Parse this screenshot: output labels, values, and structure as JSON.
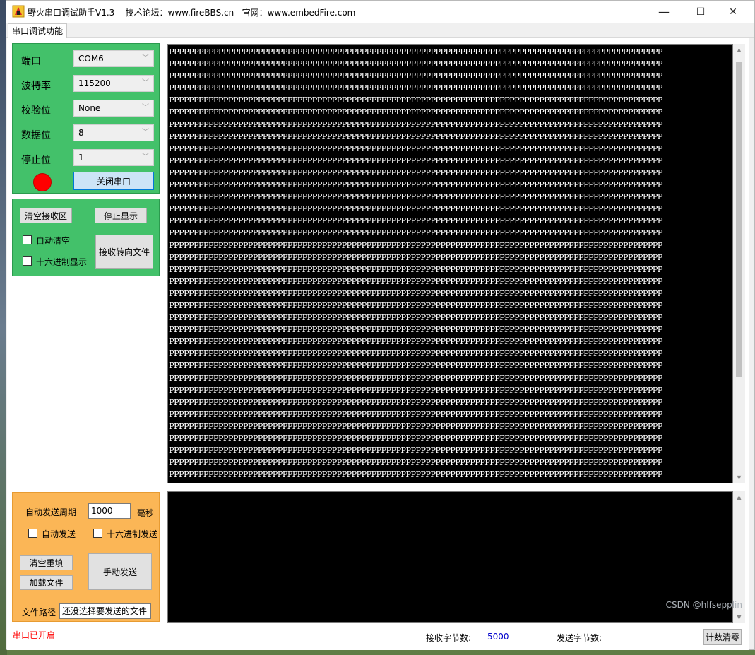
{
  "window": {
    "title": "野火串口调试助手V1.3    技术论坛：www.fireBBS.cn   官网：www.embedFire.com",
    "minimize": "—",
    "maximize": "☐",
    "close": "✕"
  },
  "tab": {
    "label": "串口调试功能"
  },
  "serial_config": {
    "port_label": "端口",
    "port_value": "COM6",
    "baud_label": "波特率",
    "baud_value": "115200",
    "parity_label": "校验位",
    "parity_value": "None",
    "databits_label": "数据位",
    "databits_value": "8",
    "stopbits_label": "停止位",
    "stopbits_value": "1",
    "status_color": "#ff0000",
    "toggle_button": "关闭串口"
  },
  "receive_controls": {
    "clear_button": "清空接收区",
    "stop_button": "停止显示",
    "auto_clear_label": "自动清空",
    "hex_display_label": "十六进制显示",
    "redirect_button": "接收转向文件"
  },
  "send_controls": {
    "period_label": "自动发送周期",
    "period_value": "1000",
    "period_unit": "毫秒",
    "auto_send_label": "自动发送",
    "hex_send_label": "十六进制发送",
    "clear_refill_button": "清空重填",
    "load_file_button": "加载文件",
    "manual_send_button": "手动发送",
    "file_path_label": "文件路径",
    "file_path_value": "还没选择要发送的文件"
  },
  "receive_area": {
    "line": "PPPPPPPPPPPPPPPPPPPPPPPPPPPPPPPPPPPPPPPPPPPPPPPPPPPPPPPPPPPPPPPPPPPPPPPPPPPPPPPPPPPPPPPPPPPPPPPPPPPP",
    "line_count": 37
  },
  "status_bar": {
    "serial_status": "串口已开启",
    "recv_bytes_label": "接收字节数:",
    "recv_bytes_value": "5000",
    "sent_bytes_label": "发送字节数:",
    "sent_bytes_value": "",
    "reset_count_button": "计数清零"
  },
  "desktop": {
    "watermark": "CSDN @hlfsepplin"
  },
  "colors": {
    "config_panel": "#43c16a",
    "send_panel": "#fbb656",
    "text_area": "#000000",
    "status_red": "#ff0000"
  }
}
